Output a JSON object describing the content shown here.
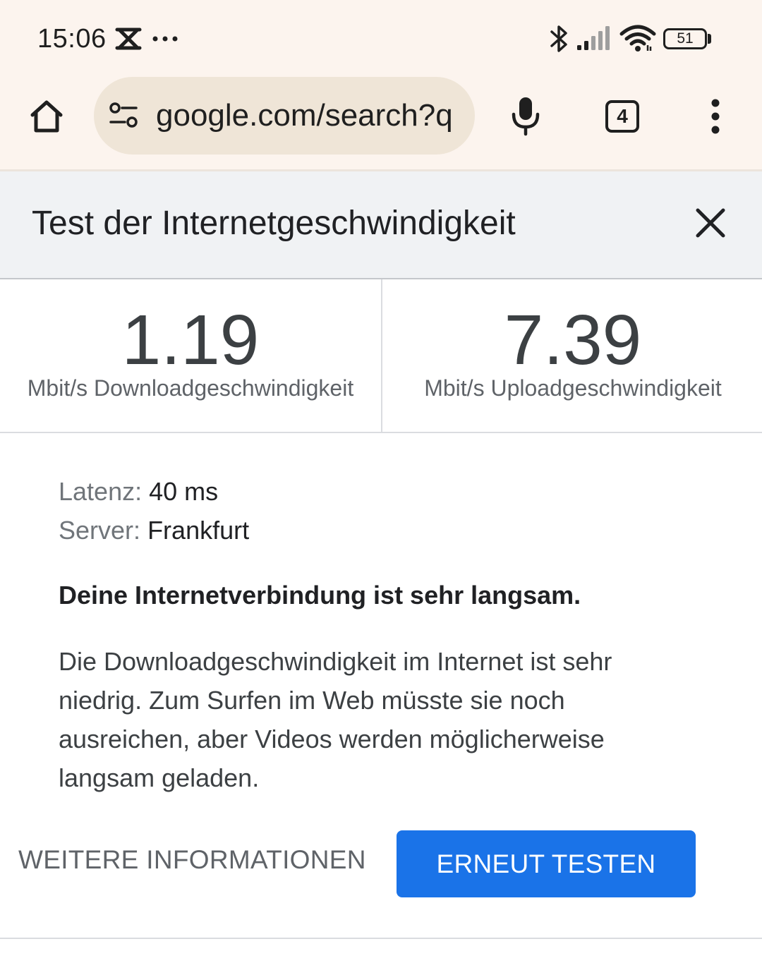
{
  "status_bar": {
    "time": "15:06",
    "battery_level": "51",
    "icons": [
      "notification-x-icon",
      "more-dots-icon",
      "bluetooth-icon",
      "cell-signal-icon",
      "wifi-icon",
      "battery-icon"
    ]
  },
  "browser": {
    "url": "google.com/search?q",
    "tab_count": "4",
    "icons": [
      "home-icon",
      "site-settings-icon",
      "microphone-icon",
      "tab-switcher-icon",
      "overflow-menu-icon"
    ]
  },
  "speed_test": {
    "title": "Test der Internetgeschwindigkeit",
    "download": {
      "value": "1.19",
      "label": "Mbit/s Downloadgeschwindigkeit"
    },
    "upload": {
      "value": "7.39",
      "label": "Mbit/s Uploadgeschwindigkeit"
    },
    "latency": {
      "key": "Latenz:",
      "value": "40 ms"
    },
    "server": {
      "key": "Server:",
      "value": "Frankfurt"
    },
    "verdict": "Deine Internetverbindung ist sehr langsam.",
    "description": "Die Downloadgeschwindigkeit im Internet ist sehr niedrig. Zum Surfen im Web müsste sie noch ausreichen, aber Videos werden möglicherweise langsam geladen.",
    "more_info_label": "WEITERE INFORMATIONEN",
    "retest_label": "ERNEUT TESTEN"
  },
  "colors": {
    "browser_chrome": "#fcf4ee",
    "url_bar": "#efe5d7",
    "header_bg": "#f0f2f4",
    "primary_button": "#1a73e8"
  }
}
